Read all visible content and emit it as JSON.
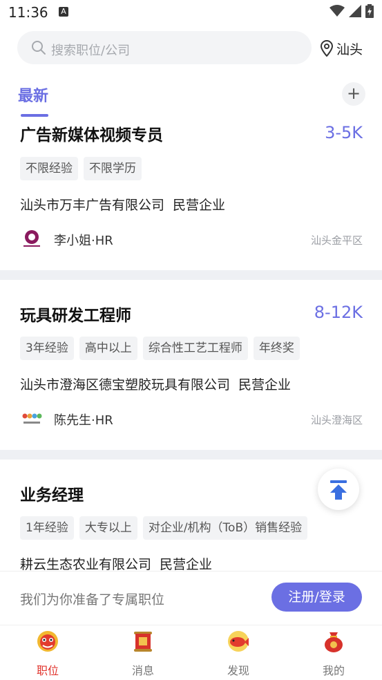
{
  "status_bar": {
    "time": "11:36",
    "notification_letter": "A"
  },
  "search": {
    "placeholder": "搜索职位/公司",
    "location": "汕头"
  },
  "tabs": {
    "latest": "最新",
    "add_symbol": "+"
  },
  "jobs": [
    {
      "title": "广告新媒体视频专员",
      "salary": "3-5K",
      "tags": [
        "不限经验",
        "不限学历"
      ],
      "company": "汕头市万丰广告有限公司",
      "company_type": "民营企业",
      "hr": "李小姐·HR",
      "area": "汕头金平区",
      "logo_color": "#8a1a5e"
    },
    {
      "title": "玩具研发工程师",
      "salary": "8-12K",
      "tags": [
        "3年经验",
        "高中以上",
        "综合性工艺工程师",
        "年终奖"
      ],
      "company": "汕头市澄海区德宝塑胶玩具有限公司",
      "company_type": "民营企业",
      "hr": "陈先生·HR",
      "area": "汕头澄海区",
      "logo_color": "#e8a23a"
    },
    {
      "title": "业务经理",
      "salary": "",
      "tags": [
        "1年经验",
        "大专以上",
        "对企业/机构（ToB）销售经验"
      ],
      "company": "耕云生态农业有限公司",
      "company_type": "民营企业"
    }
  ],
  "login_bar": {
    "prompt": "我们为你准备了专属职位",
    "button": "注册/登录"
  },
  "nav": [
    {
      "label": "职位",
      "icon": "lion-dance-icon",
      "active": true
    },
    {
      "label": "消息",
      "icon": "fortune-scroll-icon",
      "active": false
    },
    {
      "label": "发现",
      "icon": "koi-fish-icon",
      "active": false
    },
    {
      "label": "我的",
      "icon": "lucky-bag-icon",
      "active": false
    }
  ],
  "colors": {
    "accent": "#6b6fe3",
    "nav_active": "#e0322b",
    "tag_bg": "#f2f3f5"
  }
}
